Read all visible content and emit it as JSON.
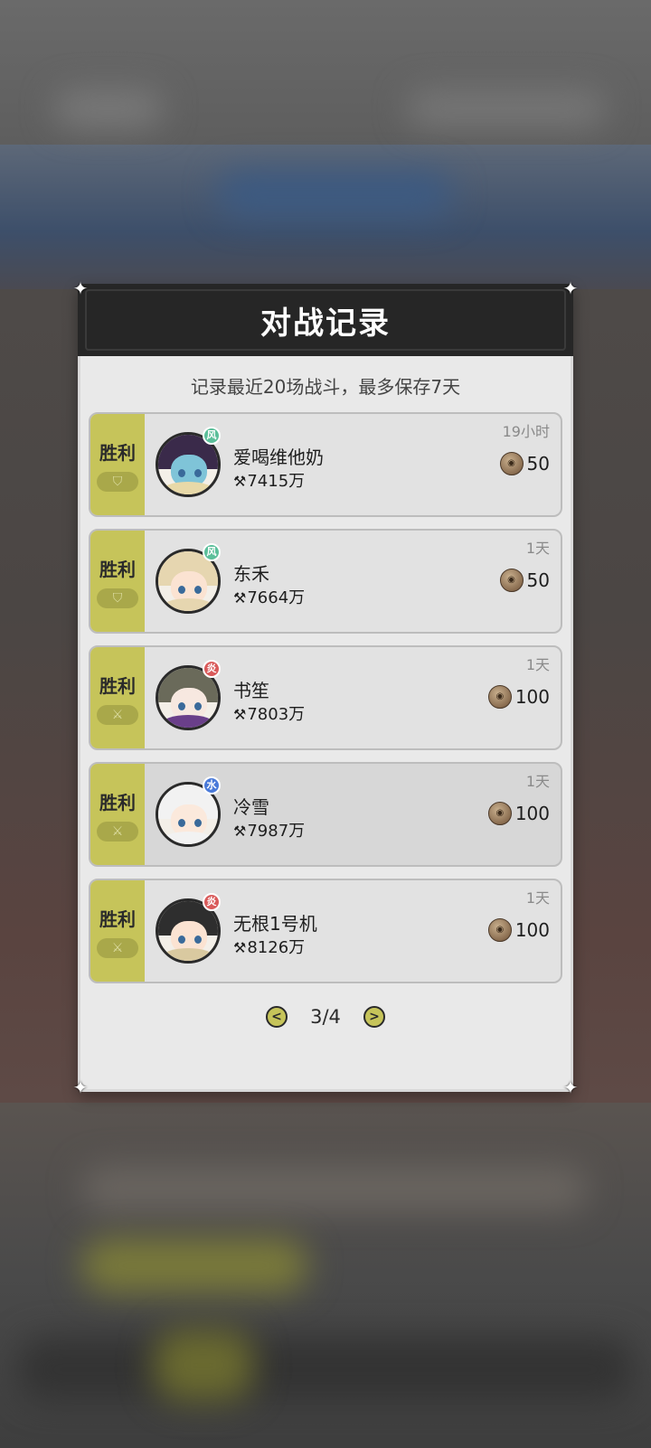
{
  "dialog": {
    "title": "对战记录",
    "subtitle": "记录最近20场战斗，最多保存7天"
  },
  "records": [
    {
      "result": "胜利",
      "badge_icon": "shield-icon",
      "name": "爱喝维他奶",
      "power": "7415万",
      "time": "19小时",
      "reward": "50",
      "element": "wind",
      "element_color": "#5bbf9a",
      "hair_color": "#e8d9a8",
      "hat_color": "#3a2a4a",
      "skin": "#7fc4d8"
    },
    {
      "result": "胜利",
      "badge_icon": "shield-icon",
      "name": "东禾",
      "power": "7664万",
      "time": "1天",
      "reward": "50",
      "element": "wind",
      "element_color": "#5bbf9a",
      "hair_color": "#e6d6b0",
      "hat_color": "#e6d6b0",
      "skin": "#fbe3d2"
    },
    {
      "result": "胜利",
      "badge_icon": "sword-icon",
      "name": "书笙",
      "power": "7803万",
      "time": "1天",
      "reward": "100",
      "element": "fire",
      "element_color": "#d95a5a",
      "hair_color": "#6a3f8a",
      "hat_color": "#6a6a5a",
      "skin": "#f7e8e0"
    },
    {
      "result": "胜利",
      "badge_icon": "sword-icon",
      "name": "冷雪",
      "power": "7987万",
      "time": "1天",
      "reward": "100",
      "element": "water",
      "element_color": "#4a7ad9",
      "hair_color": "#f2f2f2",
      "hat_color": "#f2f2f2",
      "skin": "#fbe9dc"
    },
    {
      "result": "胜利",
      "badge_icon": "sword-icon",
      "name": "无根1号机",
      "power": "8126万",
      "time": "1天",
      "reward": "100",
      "element": "fire",
      "element_color": "#d95a5a",
      "hair_color": "#d9c9a0",
      "hat_color": "#2e2e2e",
      "skin": "#fbe3d2"
    }
  ],
  "pager": {
    "text": "3/4",
    "prev_icon": "chevron-left-icon",
    "next_icon": "chevron-right-icon"
  },
  "colors": {
    "accent": "#c6c45a",
    "header": "#262626",
    "panel": "#e9e9e9"
  }
}
